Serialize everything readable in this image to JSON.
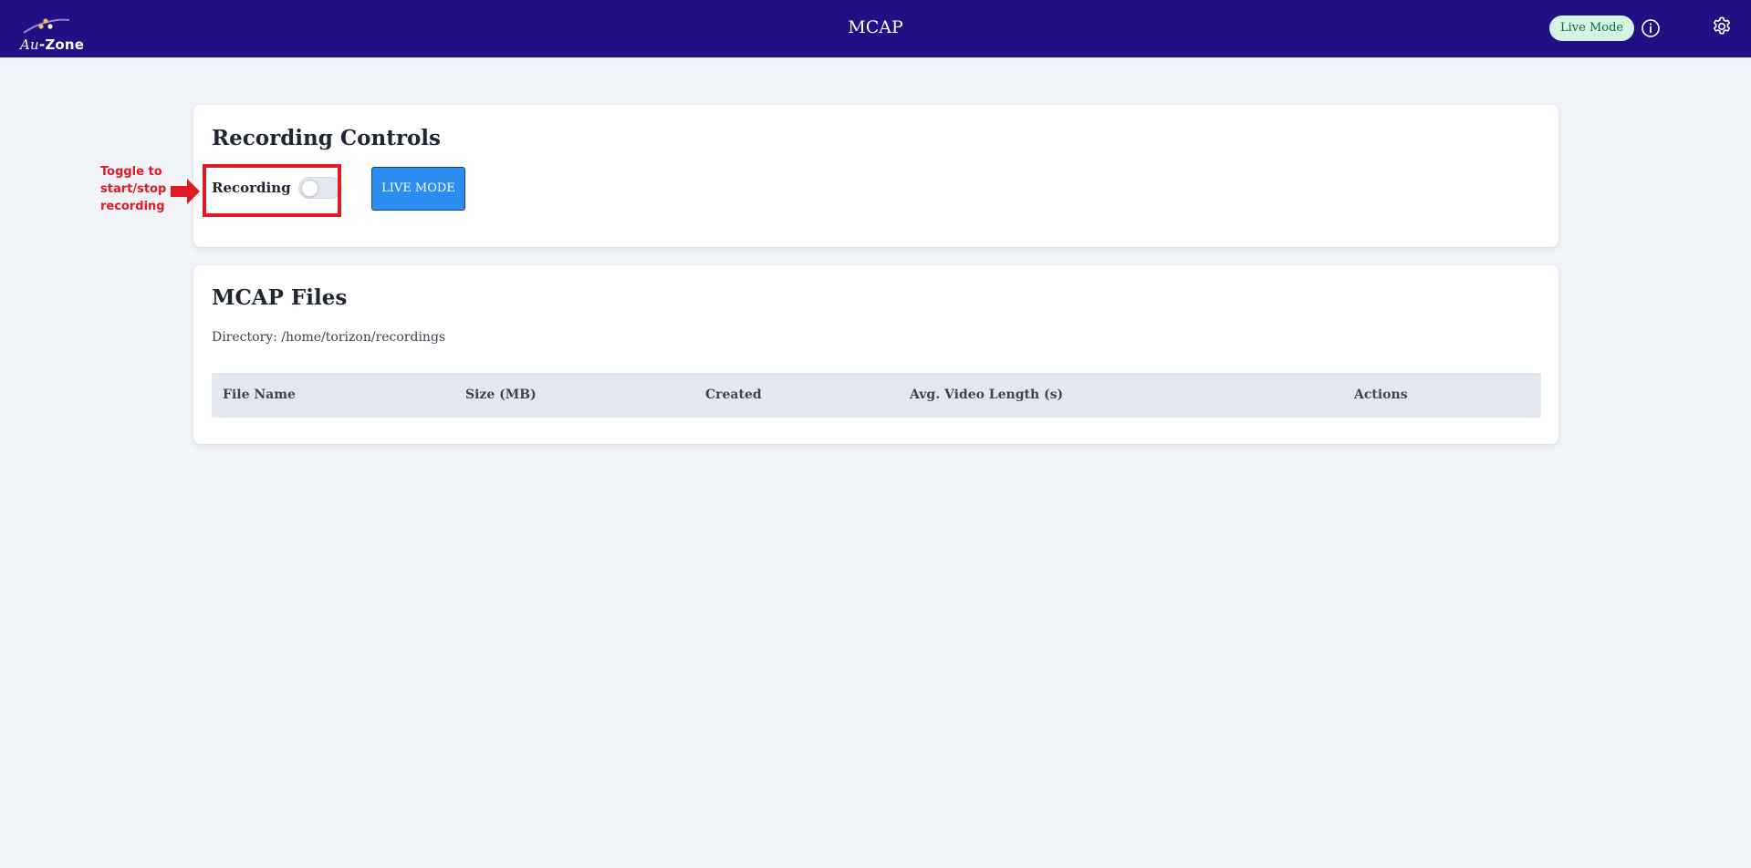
{
  "header": {
    "logo_prefix": "Au",
    "logo_suffix": "-Zone",
    "title": "MCAP",
    "mode_badge": "Live Mode",
    "info_icon": "info-icon",
    "settings_icon": "gear-icon",
    "colors": {
      "bar": "#220f83",
      "badge_bg": "#d3f5e3",
      "badge_text": "#146b3a"
    }
  },
  "recording_controls": {
    "title": "Recording Controls",
    "toggle_label": "Recording",
    "toggle_state": "off",
    "live_mode_button": "LIVE MODE",
    "button_color": "#2b8df0"
  },
  "mcap_files": {
    "title": "MCAP Files",
    "directory": "Directory: /home/torizon/recordings",
    "columns": [
      "File Name",
      "Size (MB)",
      "Created",
      "Avg. Video Length (s)",
      "Actions"
    ],
    "rows": []
  },
  "annotation": {
    "lines": [
      "Toggle to",
      "start/stop",
      "recording"
    ],
    "color": "#e01b24"
  }
}
